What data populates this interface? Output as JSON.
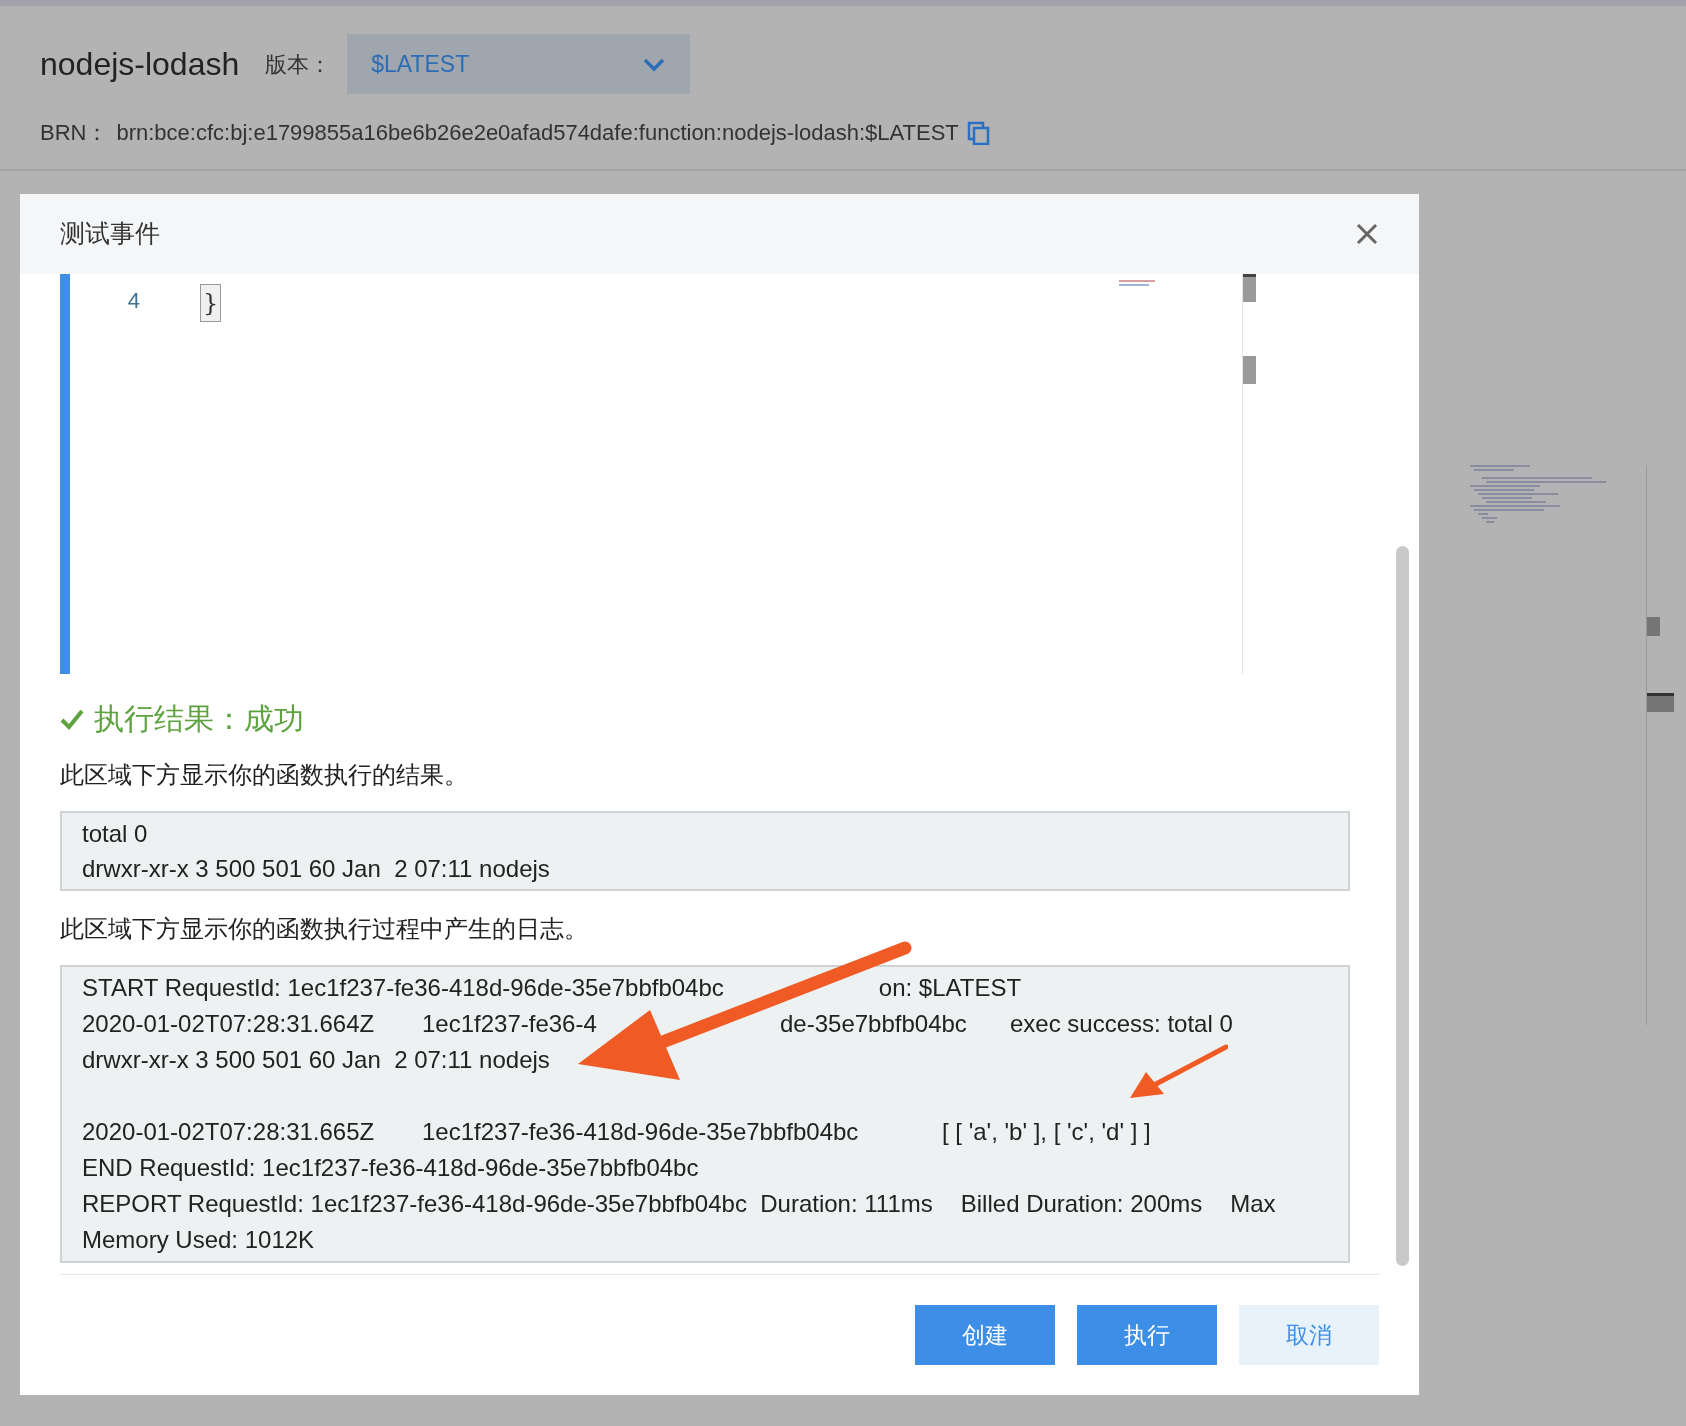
{
  "page": {
    "function_name": "nodejs-lodash",
    "version_label": "版本：",
    "version_value": "$LATEST",
    "brn_label": "BRN：",
    "brn_value": "brn:bce:cfc:bj:e1799855a16be6b26e2e0afad574dafe:function:nodejs-lodash:$LATEST"
  },
  "dialog": {
    "title": "测试事件",
    "editor": {
      "line_number": "4",
      "code": "}"
    },
    "result": {
      "status": "执行结果：成功",
      "success": true,
      "output_hint": "此区域下方显示你的函数执行的结果。",
      "output_lines": [
        "total 0",
        "drwxr-xr-x 3 500 501 60 Jan  2 07:11 nodejs"
      ],
      "log_hint": "此区域下方显示你的函数执行过程中产生的日志。",
      "log_lines": [
        {
          "kind": "covered_text",
          "parts": [
            "START RequestId: 1ec1f237-fe36-418d-96de-35e7bbfb04bc",
            "on: $LATEST"
          ]
        },
        {
          "kind": "covered_columns",
          "parts": [
            "2020-01-02T07:28:31.664Z",
            "1ec1f237-fe36-4",
            "de-35e7bbfb04bc",
            "exec success: total 0"
          ]
        },
        {
          "kind": "text",
          "parts": [
            "drwxr-xr-x 3 500 501 60 Jan  2 07:11 nodejs"
          ]
        },
        {
          "kind": "columns",
          "gap_before": true,
          "parts": [
            "2020-01-02T07:28:31.665Z",
            "1ec1f237-fe36-418d-96de-35e7bbfb04bc",
            "[ [ 'a', 'b' ], [ 'c', 'd' ] ]"
          ]
        },
        {
          "kind": "text",
          "parts": [
            "END RequestId: 1ec1f237-fe36-418d-96de-35e7bbfb04bc"
          ]
        },
        {
          "kind": "text",
          "parts": [
            "REPORT RequestId: 1ec1f237-fe36-418d-96de-35e7bbfb04bc  Duration: 111ms",
            "Billed Duration: 200ms",
            "Max"
          ]
        },
        {
          "kind": "text",
          "parts": [
            "Memory Used: 1012K"
          ]
        }
      ]
    },
    "buttons": [
      {
        "label": "创建",
        "kind": "primary"
      },
      {
        "label": "执行",
        "kind": "primary"
      },
      {
        "label": "取消",
        "kind": "secondary"
      }
    ]
  }
}
